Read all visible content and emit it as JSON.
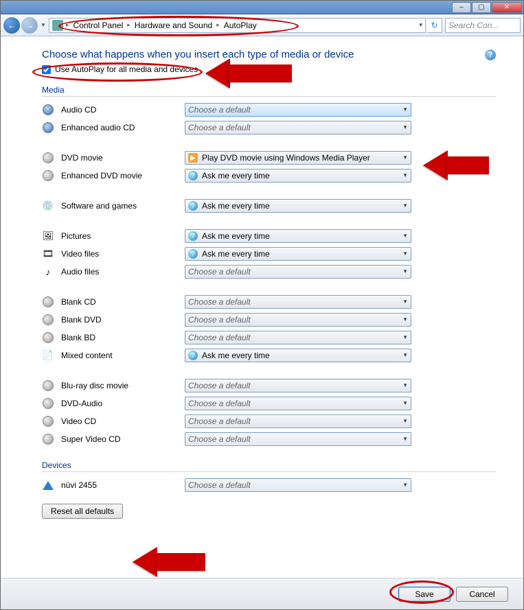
{
  "window": {
    "minimize": "–",
    "maximize": "▢",
    "close": "✕"
  },
  "nav": {
    "back": "←",
    "forward": "→",
    "dropdown": "▼",
    "crumbs": [
      "Control Panel",
      "Hardware and Sound",
      "AutoPlay"
    ],
    "sep": "▸",
    "path_dropdown": "▾",
    "refresh": "↻",
    "search_placeholder": "Search Con..."
  },
  "heading": "Choose what happens when you insert each type of media or device",
  "use_autoplay_label": "Use AutoPlay for all media and devices",
  "use_autoplay_checked": true,
  "sections": {
    "media": "Media",
    "devices": "Devices"
  },
  "default_text": "Choose a default",
  "rows": {
    "audio_cd": {
      "label": "Audio CD",
      "value": "Choose a default",
      "kind": "default"
    },
    "enh_audio_cd": {
      "label": "Enhanced audio CD",
      "value": "Choose a default",
      "kind": "default"
    },
    "dvd_movie": {
      "label": "DVD movie",
      "value": "Play DVD movie using Windows Media Player",
      "kind": "wmp"
    },
    "enh_dvd_movie": {
      "label": "Enhanced DVD movie",
      "value": "Ask me every time",
      "kind": "ask"
    },
    "software_games": {
      "label": "Software and games",
      "value": "Ask me every time",
      "kind": "ask"
    },
    "pictures": {
      "label": "Pictures",
      "value": "Ask me every time",
      "kind": "ask"
    },
    "video_files": {
      "label": "Video files",
      "value": "Ask me every time",
      "kind": "ask"
    },
    "audio_files": {
      "label": "Audio files",
      "value": "Choose a default",
      "kind": "default"
    },
    "blank_cd": {
      "label": "Blank CD",
      "value": "Choose a default",
      "kind": "default"
    },
    "blank_dvd": {
      "label": "Blank DVD",
      "value": "Choose a default",
      "kind": "default"
    },
    "blank_bd": {
      "label": "Blank BD",
      "value": "Choose a default",
      "kind": "default"
    },
    "mixed_content": {
      "label": "Mixed content",
      "value": "Ask me every time",
      "kind": "ask"
    },
    "bluray_movie": {
      "label": "Blu-ray disc movie",
      "value": "Choose a default",
      "kind": "default"
    },
    "dvd_audio": {
      "label": "DVD-Audio",
      "value": "Choose a default",
      "kind": "default"
    },
    "video_cd": {
      "label": "Video CD",
      "value": "Choose a default",
      "kind": "default"
    },
    "super_video_cd": {
      "label": "Super Video CD",
      "value": "Choose a default",
      "kind": "default"
    },
    "nuvi": {
      "label": "nüvi 2455",
      "value": "Choose a default",
      "kind": "default"
    }
  },
  "reset_label": "Reset all defaults",
  "footer": {
    "save": "Save",
    "cancel": "Cancel"
  },
  "help_icon": "?"
}
